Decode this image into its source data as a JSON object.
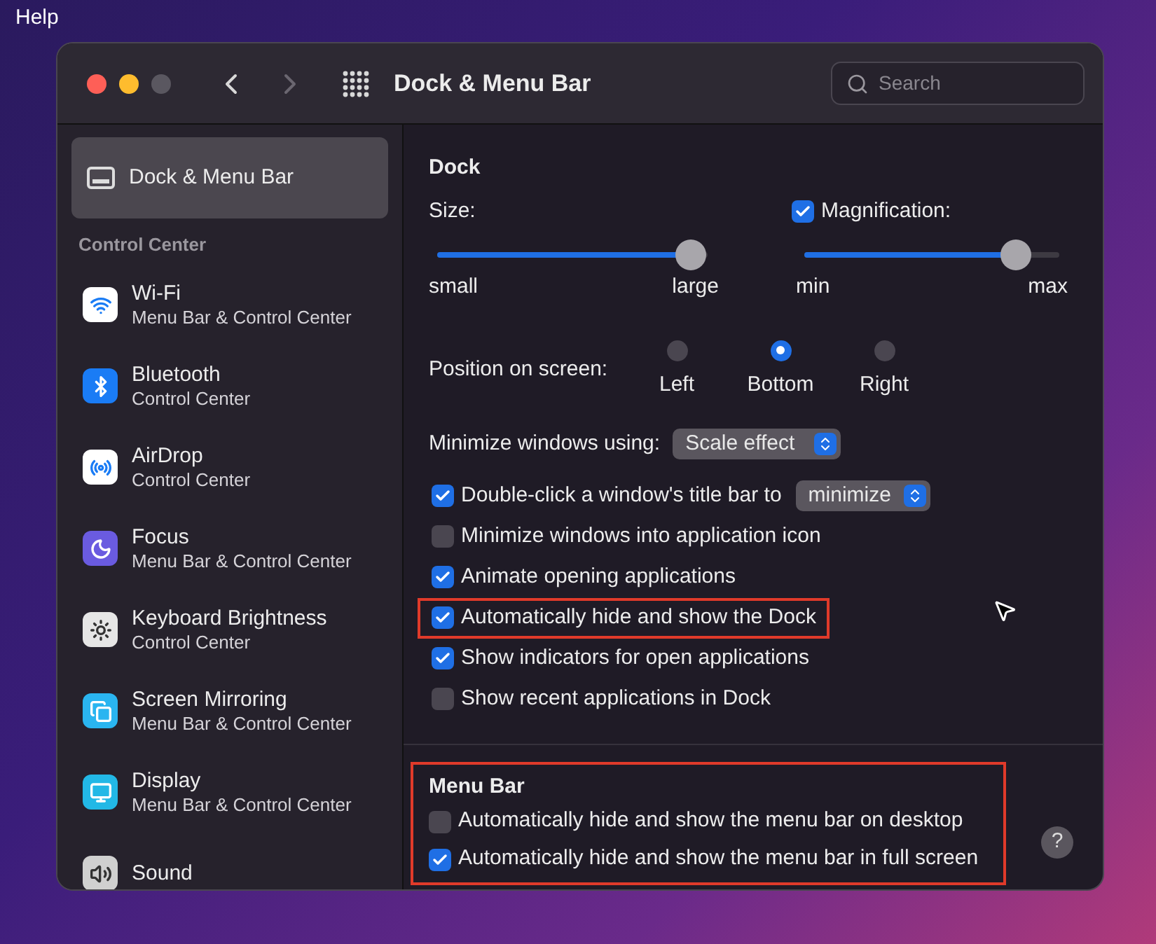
{
  "menu_bar": {
    "items": [
      "Help"
    ]
  },
  "window": {
    "title": "Dock & Menu Bar",
    "search": {
      "placeholder": "Search"
    }
  },
  "sidebar": {
    "selected_item": {
      "label": "Dock & Menu Bar",
      "selected": true
    },
    "section": "Control Center",
    "items": [
      {
        "label": "Wi-Fi",
        "subtitle": "Menu Bar & Control Center",
        "selected": false
      },
      {
        "label": "Bluetooth",
        "subtitle": "Control Center",
        "selected": false
      },
      {
        "label": "AirDrop",
        "subtitle": "Control Center",
        "selected": false
      },
      {
        "label": "Focus",
        "subtitle": "Menu Bar & Control Center",
        "selected": false
      },
      {
        "label": "Keyboard Brightness",
        "subtitle": "Control Center",
        "selected": false
      },
      {
        "label": "Screen Mirroring",
        "subtitle": "Menu Bar & Control Center",
        "selected": false
      },
      {
        "label": "Display",
        "subtitle": "Menu Bar & Control Center",
        "selected": false
      },
      {
        "label": "Sound",
        "selected": false
      }
    ]
  },
  "dock": {
    "title": "Dock",
    "size": {
      "label": "Size:",
      "level": 0.94,
      "min_label": "small",
      "max_label": "large"
    },
    "magnification": {
      "label": "Magnification:",
      "checked": true,
      "level": 0.83,
      "min_label": "min",
      "max_label": "max"
    },
    "position": {
      "label": "Position on screen:",
      "options": [
        {
          "label": "Left",
          "selected": false
        },
        {
          "label": "Bottom",
          "selected": true
        },
        {
          "label": "Right",
          "selected": false
        }
      ]
    },
    "minimize_using": {
      "label": "Minimize windows using:",
      "value": "Scale effect"
    },
    "options": [
      {
        "kind": "checkbox-select",
        "label": "Double-click a window's title bar to",
        "checked": true,
        "highlighted": false,
        "value": "minimize"
      },
      {
        "kind": "checkbox",
        "label": "Minimize windows into application icon",
        "checked": false,
        "highlighted": false
      },
      {
        "kind": "checkbox",
        "label": "Animate opening applications",
        "checked": true,
        "highlighted": false
      },
      {
        "kind": "checkbox",
        "label": "Automatically hide and show the Dock",
        "checked": true,
        "highlighted": true
      },
      {
        "kind": "checkbox",
        "label": "Show indicators for open applications",
        "checked": true,
        "highlighted": false
      },
      {
        "kind": "checkbox",
        "label": "Show recent applications in Dock",
        "checked": false,
        "highlighted": false
      }
    ]
  },
  "menu_bar_section": {
    "title": "Menu Bar",
    "highlighted": true,
    "options": [
      {
        "label": "Automatically hide and show the menu bar on desktop",
        "checked": false
      },
      {
        "label": "Automatically hide and show the menu bar in full screen",
        "checked": true
      }
    ]
  },
  "help_button": "?"
}
